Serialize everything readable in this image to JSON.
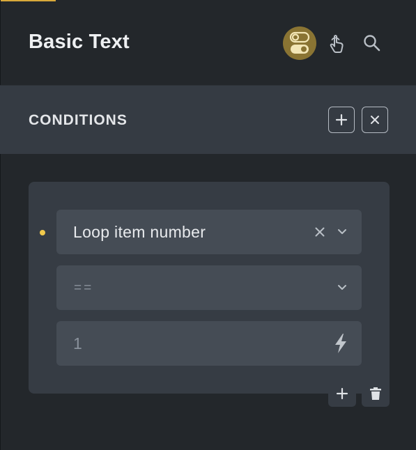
{
  "header": {
    "title": "Basic Text",
    "icons": [
      "toggle-icon",
      "pointer-icon",
      "search-icon"
    ]
  },
  "conditions": {
    "title": "CONDITIONS",
    "actions": [
      "plus-icon",
      "close-icon"
    ]
  },
  "condition": {
    "key_value": "Loop item number",
    "operator_value": "==",
    "compare_value": "1",
    "compare_icon": "dynamic-data-icon"
  },
  "footer": {
    "actions": [
      "plus-icon",
      "trash-icon"
    ]
  },
  "colors": {
    "background": "#23272b",
    "bar": "#353b43",
    "card": "#363c44",
    "field": "#454c55",
    "accent": "#d9a93a",
    "dot": "#f1c94c"
  }
}
